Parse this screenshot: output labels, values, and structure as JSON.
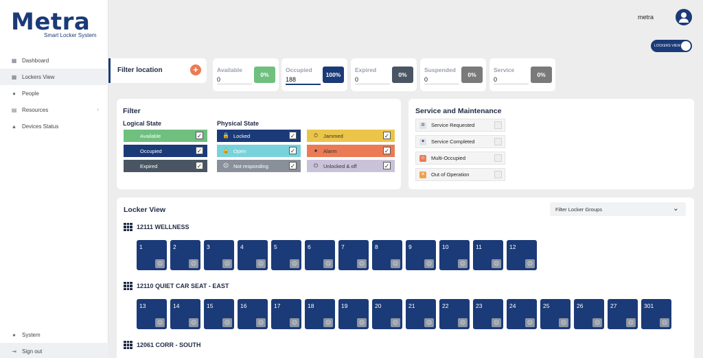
{
  "brand": {
    "name": "Metra",
    "tagline": "Smart Locker System"
  },
  "user": {
    "name": "metra"
  },
  "view_toggle": {
    "label": "LOCKERS VIEW"
  },
  "nav": {
    "items": [
      {
        "label": "Dashboard",
        "icon": "dashboard-icon"
      },
      {
        "label": "Lockers View",
        "icon": "grid-icon"
      },
      {
        "label": "People",
        "icon": "people-icon"
      },
      {
        "label": "Resources",
        "icon": "resources-icon"
      },
      {
        "label": "Devices Status",
        "icon": "devices-icon"
      }
    ],
    "bottom": [
      {
        "label": "System",
        "icon": "info-icon"
      },
      {
        "label": "Sign out",
        "icon": "signout-icon"
      }
    ]
  },
  "filter_location": {
    "label": "Filter location",
    "add": "+"
  },
  "stats": [
    {
      "label": "Available",
      "value": "0",
      "percent": "0%",
      "color": "#6fbf7f"
    },
    {
      "label": "Occupied",
      "value": "188",
      "percent": "100%",
      "color": "#1b3a78"
    },
    {
      "label": "Expired",
      "value": "0",
      "percent": "0%",
      "color": "#4a5563"
    },
    {
      "label": "Suspended",
      "value": "0",
      "percent": "0%",
      "color": "#7a7a7a"
    },
    {
      "label": "Service",
      "value": "0",
      "percent": "0%",
      "color": "#7a7a7a"
    }
  ],
  "filter": {
    "title": "Filter",
    "logical_title": "Logical State",
    "logical": [
      {
        "label": "Available",
        "color": "#6fbf7f",
        "checked": "✓"
      },
      {
        "label": "Occupied",
        "color": "#1b3a78",
        "checked": "✓"
      },
      {
        "label": "Expired",
        "color": "#4a5563",
        "checked": "✓"
      }
    ],
    "physical_title": "Physical State",
    "physical_left": [
      {
        "label": "Locked",
        "color": "#1b3a78",
        "icon": "🔒",
        "checked": "✓"
      },
      {
        "label": "Open",
        "color": "#78d2db",
        "icon": "🔓",
        "checked": "✓"
      },
      {
        "label": "Not responding",
        "color": "#8a9099",
        "icon": "☹",
        "checked": "✓"
      }
    ],
    "physical_right": [
      {
        "label": "Jammed",
        "color": "#ebc549",
        "icon": "⏱",
        "checked": "✓",
        "text_color": "#333333"
      },
      {
        "label": "Alarm",
        "color": "#ea7b55",
        "icon": "●",
        "checked": "✓",
        "text_color": "#333333"
      },
      {
        "label": "Unlocked & off",
        "color": "#c9c2d9",
        "icon": "⏻",
        "checked": "✓",
        "text_color": "#333333"
      }
    ]
  },
  "service": {
    "title": "Service and Maintenance",
    "items": [
      {
        "label": "Service Requested",
        "icon": "✲",
        "icon_bg": "#dfe3ea"
      },
      {
        "label": "Service Completed",
        "icon": "✦",
        "icon_bg": "#dfe3ea"
      },
      {
        "label": "Multi-Occupied",
        "icon": "☺",
        "icon_bg": "#ea7b55"
      },
      {
        "label": "Out of Operation",
        "icon": "✕",
        "icon_bg": "#f0a04b"
      }
    ]
  },
  "locker_view": {
    "title": "Locker View",
    "filter_groups": "Filter Locker Groups",
    "groups": [
      {
        "name": "12111 WELLNESS",
        "lockers": [
          "1",
          "2",
          "3",
          "4",
          "5",
          "6",
          "7",
          "8",
          "9",
          "10",
          "11",
          "12"
        ]
      },
      {
        "name": "12110 QUIET CAR SEAT - EAST",
        "lockers": [
          "13",
          "14",
          "15",
          "16",
          "17",
          "18",
          "19",
          "20",
          "21",
          "22",
          "23",
          "24",
          "25",
          "26",
          "27",
          "301"
        ]
      },
      {
        "name": "12061 CORR - SOUTH",
        "lockers": []
      }
    ]
  }
}
